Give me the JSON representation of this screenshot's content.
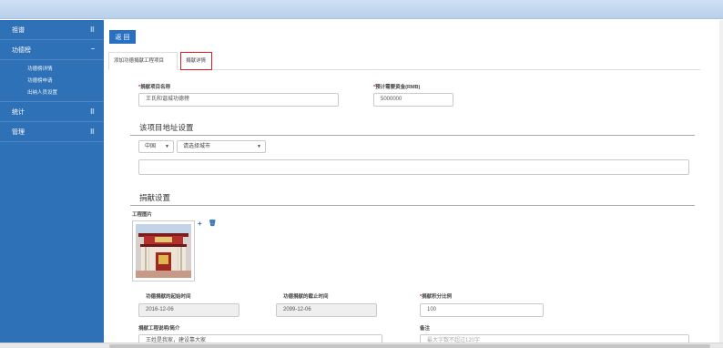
{
  "sidebar": {
    "items": [
      {
        "label": "祖谱",
        "mark": "⠿"
      },
      {
        "label": "功德榜",
        "mark": "−"
      },
      {
        "label": "统计",
        "mark": "⠿"
      },
      {
        "label": "管理",
        "mark": "⠿"
      }
    ],
    "sub_items": [
      "功德榜详情",
      "功德榜申请",
      "出纳人员设置"
    ]
  },
  "toolbar": {
    "back_label": "返 回"
  },
  "tabs": [
    {
      "label": "添加功德捐献工程项目"
    },
    {
      "label": "捐献详情"
    }
  ],
  "form": {
    "project_name_label": "捐献项目名称",
    "project_name_value": "王氏和谐城功德榜",
    "funds_label": "预计需要资金(RMB)",
    "funds_value": "5000000",
    "address_section": "该项目地址设置",
    "country_value": "中国",
    "city_placeholder": "请选择城市",
    "address_value": "",
    "donation_section": "捐献设置",
    "image_label": "工程图片",
    "start_label": "功德捐献的起始时间",
    "start_value": "2016-12-06",
    "end_label": "功德捐献的截止时间",
    "end_value": "2099-12-06",
    "ratio_label": "捐献积分比例",
    "ratio_value": "100",
    "desc_label": "捐献工程说明/简介",
    "desc_value": "王姓是我家，建设靠大家",
    "note_label": "备注",
    "note_placeholder": "最大字数不超过120字"
  },
  "icons": {
    "add": "plus-icon",
    "delete": "trash-icon"
  },
  "colors": {
    "sidebar": "#2f71b6",
    "accent": "#2a70c2",
    "required": "#e02020"
  }
}
